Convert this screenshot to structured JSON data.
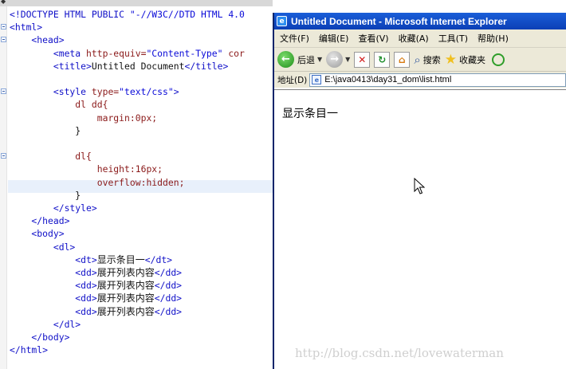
{
  "editor": {
    "lines": [
      [
        {
          "t": "<!DOCTYPE HTML PUBLIC ",
          "c": "tag"
        },
        {
          "t": "\"-//W3C//DTD HTML 4.0",
          "c": "str"
        }
      ],
      [
        {
          "t": "<html>",
          "c": "tag"
        }
      ],
      [
        {
          "t": "    <head>",
          "c": "tag"
        }
      ],
      [
        {
          "t": "        <meta ",
          "c": "tag"
        },
        {
          "t": "http-equiv=",
          "c": "attr"
        },
        {
          "t": "\"Content-Type\"",
          "c": "str"
        },
        {
          "t": " cor",
          "c": "attr"
        }
      ],
      [
        {
          "t": "        <title>",
          "c": "tag"
        },
        {
          "t": "Untitled Document",
          "c": "txt"
        },
        {
          "t": "</title>",
          "c": "tag"
        }
      ],
      [],
      [
        {
          "t": "        <style ",
          "c": "tag"
        },
        {
          "t": "type=",
          "c": "attr"
        },
        {
          "t": "\"text/css\"",
          "c": "str"
        },
        {
          "t": ">",
          "c": "tag"
        }
      ],
      [
        {
          "t": "            dl dd{",
          "c": "cssp"
        }
      ],
      [
        {
          "t": "                margin:0px;",
          "c": "cssp"
        }
      ],
      [
        {
          "t": "            }",
          "c": "txt"
        }
      ],
      [],
      [
        {
          "t": "            dl{",
          "c": "cssp"
        }
      ],
      [
        {
          "t": "                height:16px;",
          "c": "cssp"
        }
      ],
      [
        {
          "t": "                overflow:hidden;",
          "c": "cssp"
        }
      ],
      [
        {
          "t": "            }",
          "c": "txt"
        }
      ],
      [
        {
          "t": "        </style>",
          "c": "tag"
        }
      ],
      [
        {
          "t": "    </head>",
          "c": "tag"
        }
      ],
      [
        {
          "t": "    <body>",
          "c": "tag"
        }
      ],
      [
        {
          "t": "        <dl>",
          "c": "tag"
        }
      ],
      [
        {
          "t": "            <dt>",
          "c": "tag"
        },
        {
          "t": "显示条目一",
          "c": "txt zh"
        },
        {
          "t": "</dt>",
          "c": "tag"
        }
      ],
      [
        {
          "t": "            <dd>",
          "c": "tag"
        },
        {
          "t": "展开列表内容",
          "c": "txt zh"
        },
        {
          "t": "</dd>",
          "c": "tag"
        }
      ],
      [
        {
          "t": "            <dd>",
          "c": "tag"
        },
        {
          "t": "展开列表内容",
          "c": "txt zh"
        },
        {
          "t": "</dd>",
          "c": "tag"
        }
      ],
      [
        {
          "t": "            <dd>",
          "c": "tag"
        },
        {
          "t": "展开列表内容",
          "c": "txt zh"
        },
        {
          "t": "</dd>",
          "c": "tag"
        }
      ],
      [
        {
          "t": "            <dd>",
          "c": "tag"
        },
        {
          "t": "展开列表内容",
          "c": "txt zh"
        },
        {
          "t": "</dd>",
          "c": "tag"
        }
      ],
      [
        {
          "t": "        </dl>",
          "c": "tag"
        }
      ],
      [
        {
          "t": "    </body>",
          "c": "tag"
        }
      ],
      [
        {
          "t": "</html>",
          "c": "tag"
        }
      ]
    ],
    "fold_markers_on_lines": [
      1,
      2,
      6,
      11
    ],
    "icon": "fold-marker-icon"
  },
  "ie": {
    "title": "Untitled Document - Microsoft Internet Explorer",
    "menu": [
      "文件(F)",
      "编辑(E)",
      "查看(V)",
      "收藏(A)",
      "工具(T)",
      "帮助(H)"
    ],
    "toolbar": {
      "back_label": "后退",
      "search_label": "搜索",
      "favorites_label": "收藏夹"
    },
    "address": {
      "label": "地址(D)",
      "value": "E:\\java0413\\day31_dom\\list.html"
    },
    "content": {
      "dt_text": "显示条目一"
    },
    "colors": {
      "titlebar": "#0b3fb6",
      "chrome": "#ece9d8"
    }
  },
  "watermark": "http://blog.csdn.net/lovewaterman"
}
